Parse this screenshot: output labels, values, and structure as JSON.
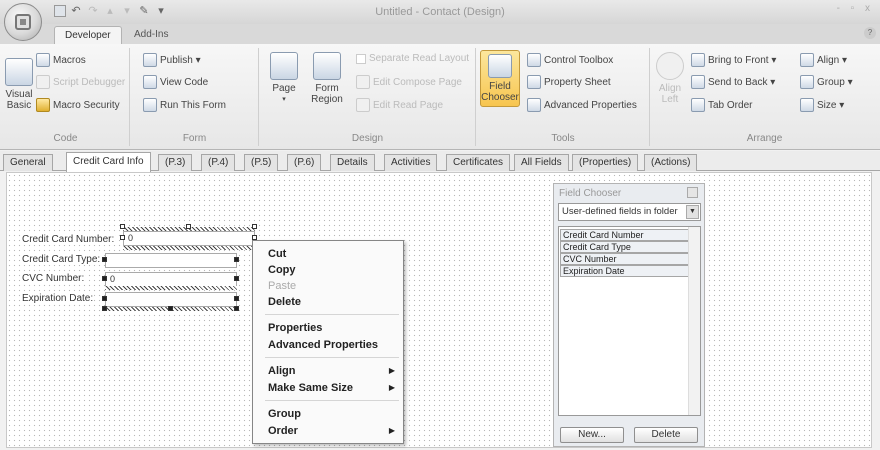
{
  "window": {
    "title": "Untitled - Contact  (Design)",
    "controls": "- ▫ x"
  },
  "quick_access": [
    "save-icon",
    "undo-icon",
    "redo-icon",
    "up-icon",
    "down-icon",
    "spell-icon",
    "customize-icon"
  ],
  "tabs": {
    "developer": "Developer",
    "addins": "Add-Ins"
  },
  "ribbon": {
    "code": {
      "label": "Code",
      "visual_basic": "Visual Basic",
      "macros": "Macros",
      "script_debugger": "Script Debugger",
      "macro_security": "Macro Security"
    },
    "form": {
      "label": "Form",
      "publish": "Publish ▾",
      "view_code": "View Code",
      "run_form": "Run This Form"
    },
    "design": {
      "label": "Design",
      "page": "Page",
      "form_region": "Form Region",
      "separate_read_layout": "Separate Read Layout",
      "edit_compose_page": "Edit Compose Page",
      "edit_read_page": "Edit Read Page"
    },
    "tools": {
      "label": "Tools",
      "field_chooser": "Field Chooser",
      "control_toolbox": "Control Toolbox",
      "property_sheet": "Property Sheet",
      "advanced_properties": "Advanced Properties"
    },
    "arrange": {
      "label": "Arrange",
      "align_left": "Align Left",
      "bring_front": "Bring to Front ▾",
      "send_back": "Send to Back ▾",
      "tab_order": "Tab Order",
      "align": "Align ▾",
      "group": "Group ▾",
      "size": "Size ▾"
    }
  },
  "page_tabs": [
    "General",
    "Credit Card Info",
    "(P.3)",
    "(P.4)",
    "(P.5)",
    "(P.6)",
    "Details",
    "Activities",
    "Certificates",
    "All Fields",
    "(Properties)",
    "(Actions)"
  ],
  "form_fields": [
    {
      "label": "Credit Card Number:",
      "value": "0"
    },
    {
      "label": "Credit Card Type:",
      "value": ""
    },
    {
      "label": "CVC Number:",
      "value": "0"
    },
    {
      "label": "Expiration Date:",
      "value": ""
    }
  ],
  "context_menu": {
    "cut": "Cut",
    "copy": "Copy",
    "paste": "Paste",
    "delete": "Delete",
    "properties": "Properties",
    "advanced_properties": "Advanced Properties",
    "align": "Align",
    "make_same_size": "Make Same Size",
    "group": "Group",
    "order": "Order"
  },
  "field_chooser": {
    "title": "Field Chooser",
    "selected": "User-defined fields in folder",
    "items": [
      "Credit Card Number",
      "Credit Card Type",
      "CVC Number",
      "Expiration Date"
    ],
    "new_label": "New...",
    "delete_label": "Delete"
  }
}
